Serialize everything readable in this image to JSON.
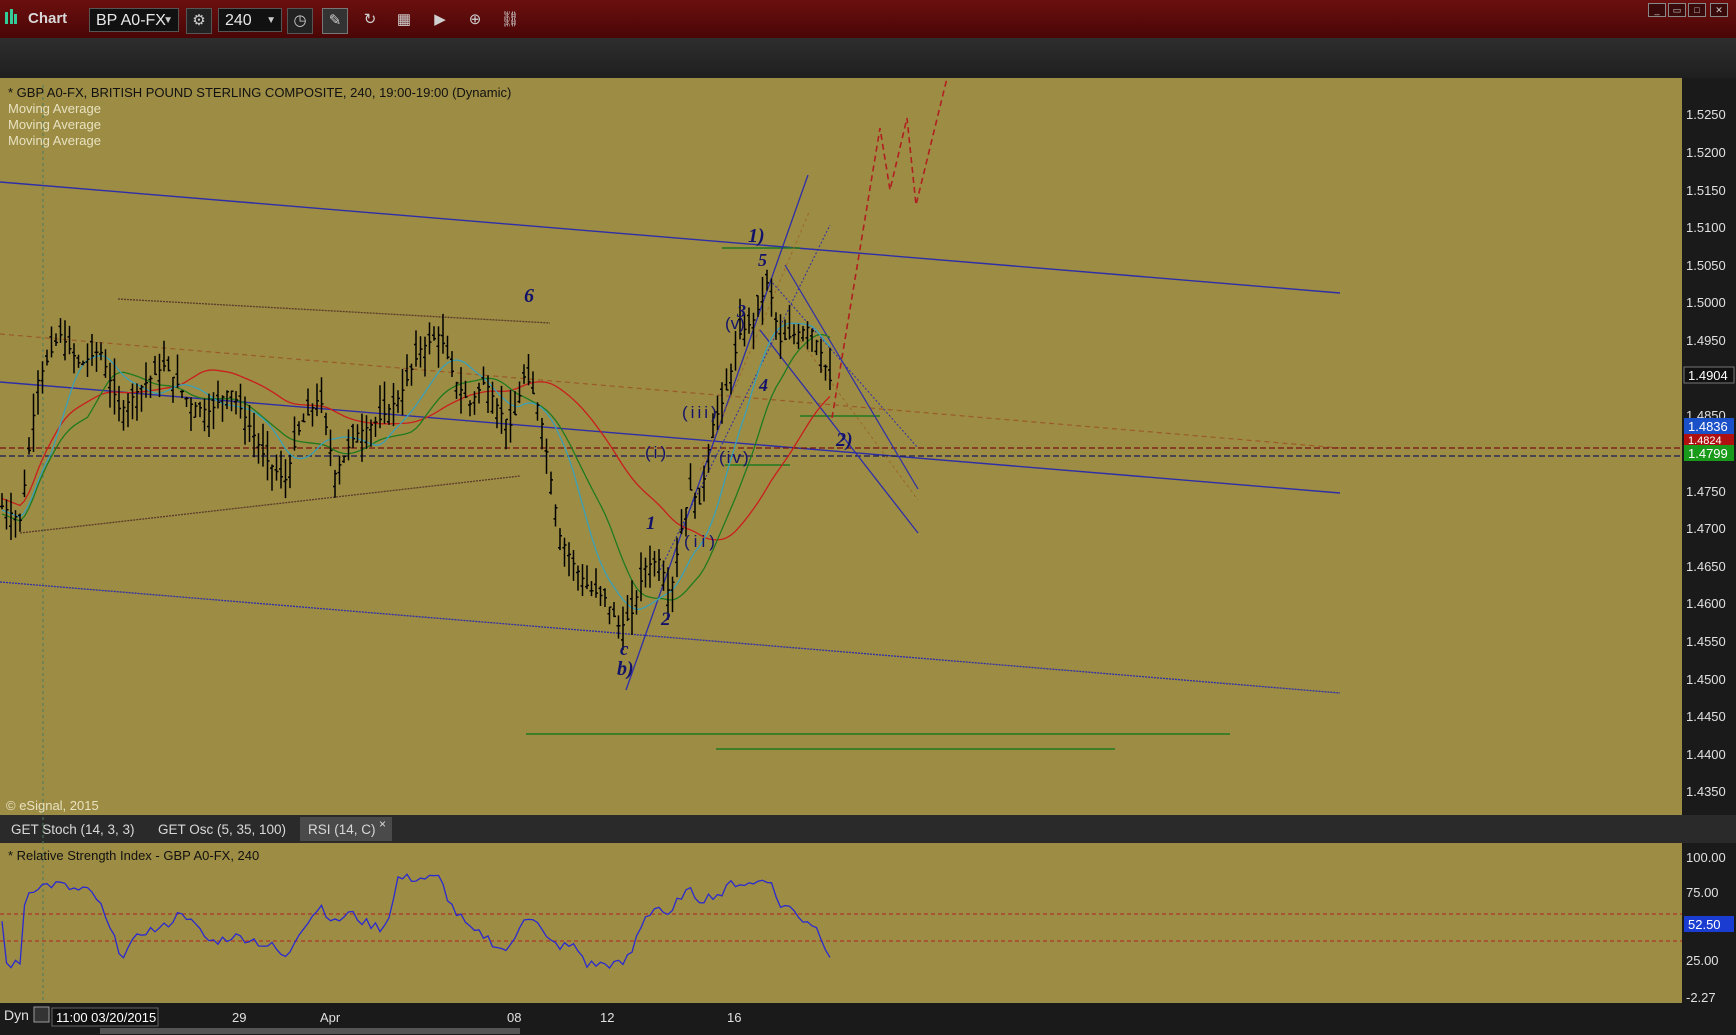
{
  "app": {
    "title": "Chart"
  },
  "toolbar": {
    "symbol": "BP A0-FX",
    "interval": "240",
    "magnet": "U"
  },
  "chart_header": {
    "line1": "* GBP A0-FX, BRITISH POUND STERLING COMPOSITE, 240, 19:00-19:00 (Dynamic)",
    "studies": [
      "Moving Average",
      "Moving Average",
      "Moving Average"
    ],
    "copyright": "© eSignal, 2015"
  },
  "price_axis": {
    "ticks": [
      "1.5250",
      "1.5200",
      "1.5150",
      "1.5100",
      "1.5050",
      "1.5000",
      "1.4950",
      "1.4850",
      "1.4750",
      "1.4700",
      "1.4650",
      "1.4600",
      "1.4550",
      "1.4500",
      "1.4450",
      "1.4400",
      "1.4350"
    ],
    "tags": [
      {
        "label": "1.4904",
        "bg": "#111111",
        "fg": "#ffffff"
      },
      {
        "label": "1.4836",
        "bg": "#1a50c8",
        "fg": "#ffffff"
      },
      {
        "label": "1.4824",
        "bg": "#b01010",
        "fg": "#ffffff"
      },
      {
        "label": "1.4799",
        "bg": "#1a9a1a",
        "fg": "#ffffff"
      }
    ]
  },
  "wave_labels": [
    "1)",
    "5",
    "6",
    "3",
    "(v)",
    "4",
    "(iii)",
    "2)",
    "(i)",
    "(iv)",
    "1",
    "(ii)",
    "2",
    "c",
    "b)"
  ],
  "tabs": [
    {
      "label": "GET Stoch (14, 3, 3)",
      "active": false
    },
    {
      "label": "GET Osc (5, 35, 100)",
      "active": false
    },
    {
      "label": "RSI (14, C)",
      "active": true
    }
  ],
  "tab_close": "×",
  "rsi": {
    "title": "* Relative Strength Index - GBP A0-FX, 240",
    "ticks": [
      "100.00",
      "75.00",
      "25.00",
      "-2.27"
    ],
    "value_tag": "52.50"
  },
  "time_axis": {
    "mode": "Dyn",
    "cursor": "11:00 03/20/2015",
    "labels": [
      "29",
      "Apr",
      "08",
      "12",
      "16"
    ]
  },
  "chart_data": {
    "type": "line",
    "series_main": "GBP A0-FX 240 OHLC bars",
    "ylim": [
      1.434,
      1.529
    ],
    "rsi_ylim": [
      -2.27,
      100
    ],
    "rsi_levels": [
      70,
      30
    ],
    "colors": {
      "background": "#9d8c44",
      "bars": "#000000",
      "channel": "#2e2ea8",
      "ma_red": "#c81e1e",
      "ma_green": "#1f7a1f",
      "ma_cyan": "#3aa0b8"
    }
  }
}
